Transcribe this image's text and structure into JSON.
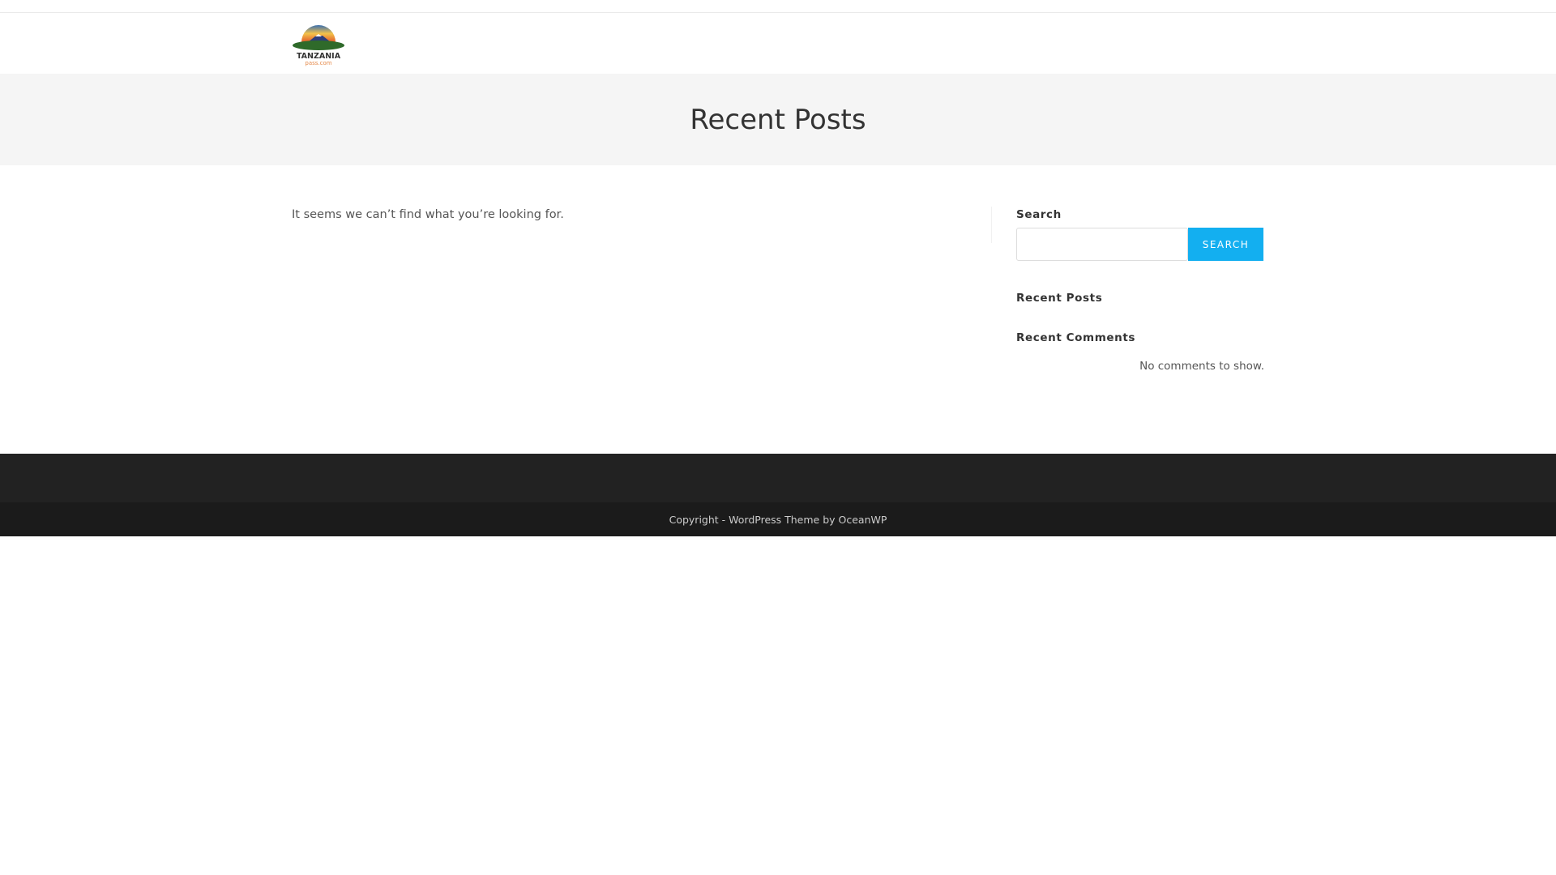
{
  "header": {
    "logo_text": "TANZANIA",
    "logo_subtext": "pass.com"
  },
  "page_title": "Recent Posts",
  "content": {
    "message": "It seems we can’t find what you’re looking for."
  },
  "sidebar": {
    "search_title": "Search",
    "search_value": "",
    "search_button": "SEARCH",
    "recent_posts_title": "Recent Posts",
    "recent_comments_title": "Recent Comments",
    "no_comments": "No comments to show."
  },
  "footer": {
    "copyright": "Copyright - WordPress Theme by OceanWP"
  },
  "colors": {
    "accent": "#13aff0",
    "footer": "#222222"
  }
}
